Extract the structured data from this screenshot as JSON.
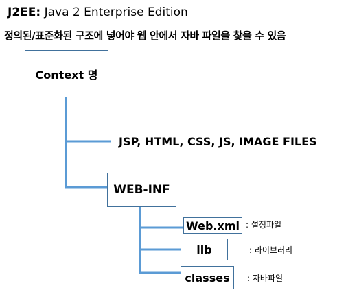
{
  "header": {
    "prefix": "J2EE:",
    "text": " Java 2 Enterprise Edition"
  },
  "subtitle": "정의된/표준화된 구조에 넣어야 웹 안에서 자바 파일을 찾을 수 있음",
  "tree": {
    "context": "Context 명",
    "files": "JSP, HTML, CSS, JS, IMAGE FILES",
    "webinf": "WEB-INF",
    "webxml": "Web.xml",
    "webxml_note": ": 설정파일",
    "lib": "lib",
    "lib_note": ": 라이브러리",
    "classes": "classes",
    "classes_note": ": 자바파일"
  },
  "colors": {
    "connector": "#5b9bd5",
    "box_border": "#41719c"
  }
}
